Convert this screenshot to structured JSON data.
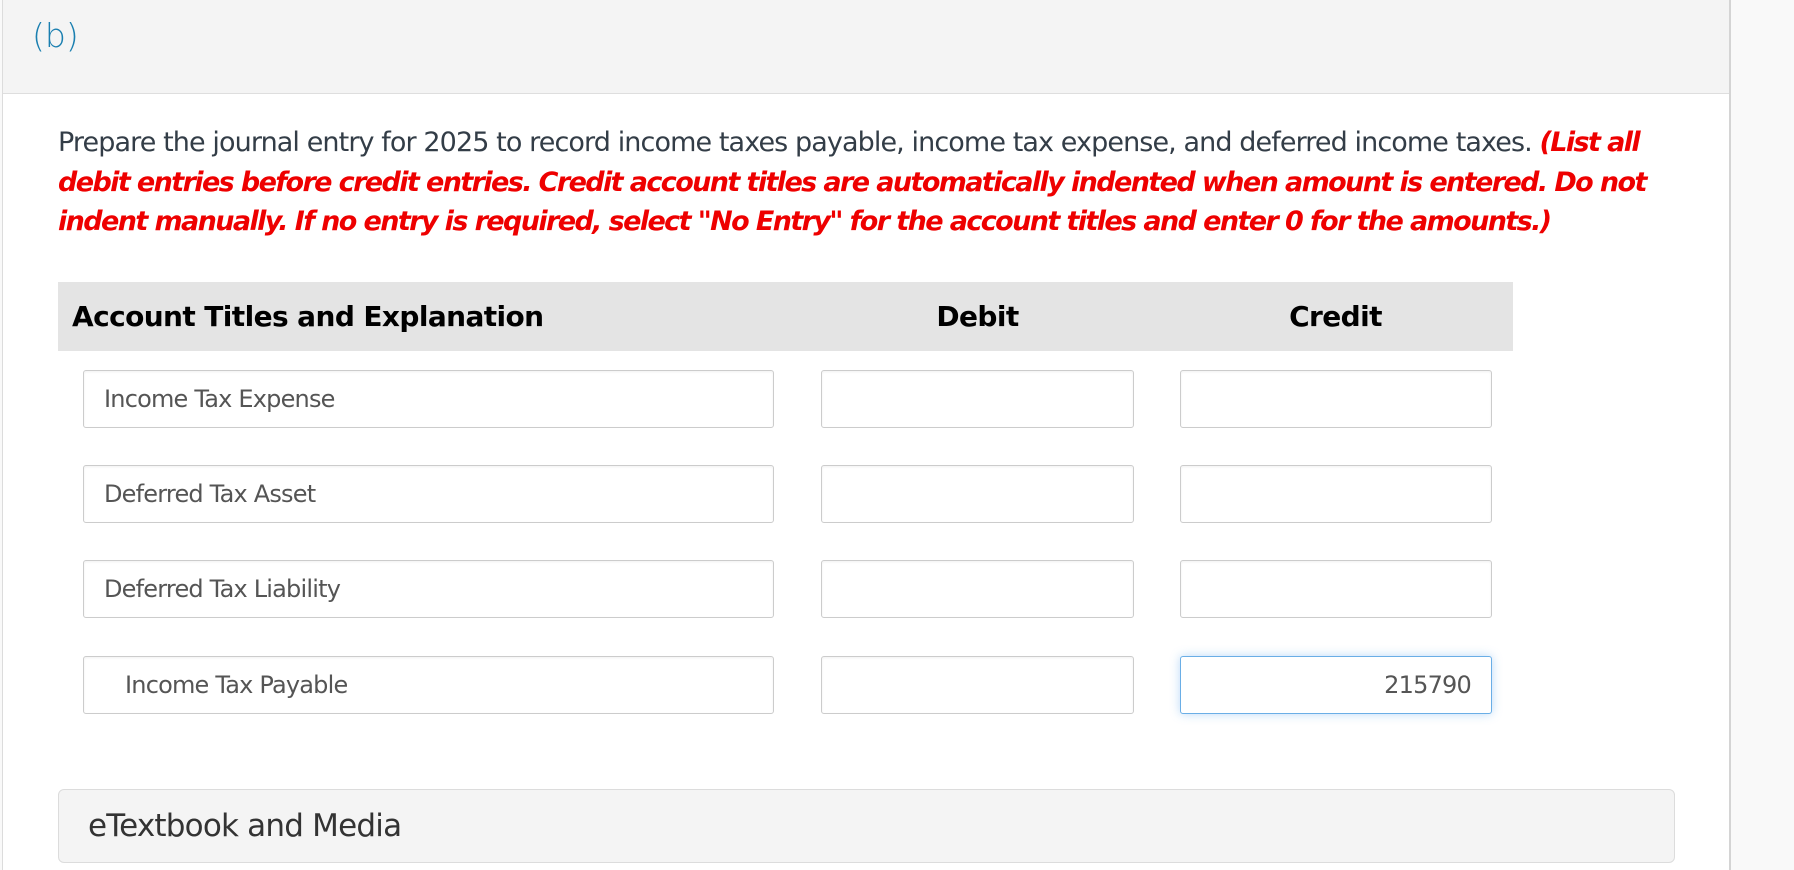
{
  "part": {
    "label": "(b)"
  },
  "question": {
    "prompt": "Prepare the journal entry for 2025 to record income taxes payable, income tax expense, and deferred income taxes. ",
    "instruction": "(List all debit entries before credit entries. Credit account titles are automatically indented when amount is entered. Do not indent manually. If no entry is required, select \"No Entry\" for the account titles and enter 0 for the amounts.)"
  },
  "journal": {
    "headers": {
      "account": "Account Titles and Explanation",
      "debit": "Debit",
      "credit": "Credit"
    },
    "rows": [
      {
        "account": "Income Tax Expense",
        "debit": "",
        "credit": ""
      },
      {
        "account": "Deferred Tax Asset",
        "debit": "",
        "credit": ""
      },
      {
        "account": "Deferred Tax Liability",
        "debit": "",
        "credit": ""
      },
      {
        "account": "Income Tax Payable",
        "debit": "",
        "credit": "215790"
      }
    ]
  },
  "media": {
    "label": "eTextbook and Media"
  },
  "colors": {
    "part_label": "#1a7fb0",
    "instruction": "#ee0000",
    "focus_border": "#6aaee6"
  }
}
